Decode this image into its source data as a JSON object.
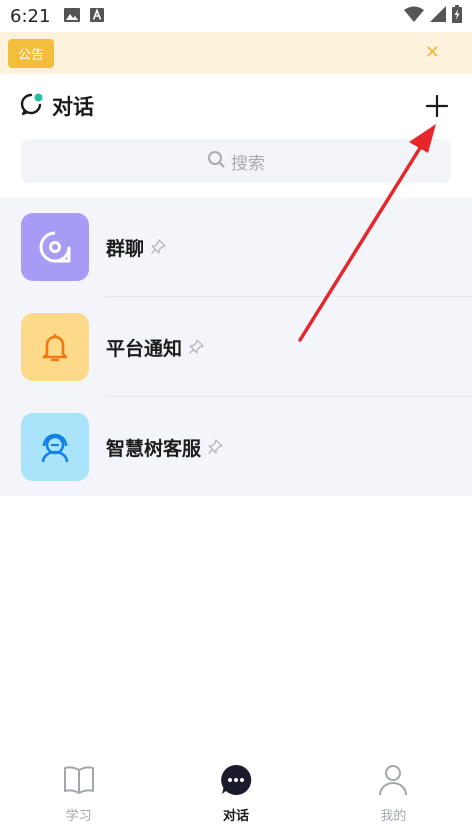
{
  "status_bar": {
    "time": "6:21",
    "left_icons": [
      "image-icon",
      "font-a-icon"
    ],
    "right_icons": [
      "wifi-icon",
      "signal-icon",
      "battery-charging-icon"
    ]
  },
  "notice": {
    "tag": "公告",
    "close_symbol": "✕",
    "accent": "#f3be3c",
    "background": "#fdf3dc"
  },
  "header": {
    "title": "对话",
    "add_symbol": "+"
  },
  "search": {
    "placeholder": "搜索"
  },
  "conversations": [
    {
      "label": "群聊",
      "icon": "group-chat-icon",
      "icon_bg": "#a69cf6",
      "pinned": true
    },
    {
      "label": "平台通知",
      "icon": "bell-icon",
      "icon_bg": "#fdd98a",
      "pinned": true
    },
    {
      "label": "智慧树客服",
      "icon": "customer-service-icon",
      "icon_bg": "#a9e4fb",
      "pinned": true
    }
  ],
  "tabbar": {
    "tabs": [
      {
        "label": "学习",
        "icon": "book-icon",
        "active": false
      },
      {
        "label": "对话",
        "icon": "chat-bubble-icon",
        "active": true
      },
      {
        "label": "我的",
        "icon": "person-icon",
        "active": false
      }
    ]
  },
  "annotation": {
    "arrow_color": "#e5262b"
  }
}
